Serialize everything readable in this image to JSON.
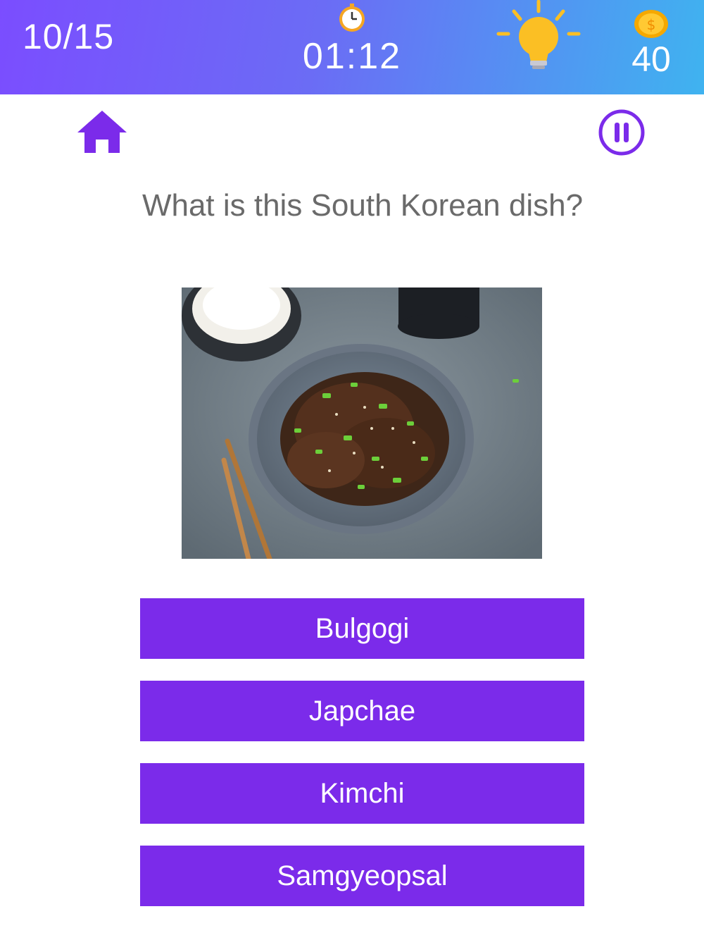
{
  "header": {
    "progress": "10/15",
    "timer": "01:12",
    "coins": "40",
    "icons": {
      "clock": "clock-icon",
      "hint": "lightbulb-icon",
      "coin": "coin-icon",
      "coin_symbol": "$"
    }
  },
  "nav": {
    "home_icon": "home-icon",
    "pause_icon": "pause-icon"
  },
  "question": {
    "text": "What is this South Korean dish?"
  },
  "answers": [
    {
      "label": "Bulgogi"
    },
    {
      "label": "Japchae"
    },
    {
      "label": "Kimchi"
    },
    {
      "label": "Samgyeopsal"
    }
  ],
  "colors": {
    "accent": "#7b2bea",
    "header_gradient_start": "#7b4dff",
    "header_gradient_end": "#3fb3f0",
    "question_text": "#6a6a6a",
    "bulb": "#fbbf24",
    "coin": "#f5a800"
  }
}
